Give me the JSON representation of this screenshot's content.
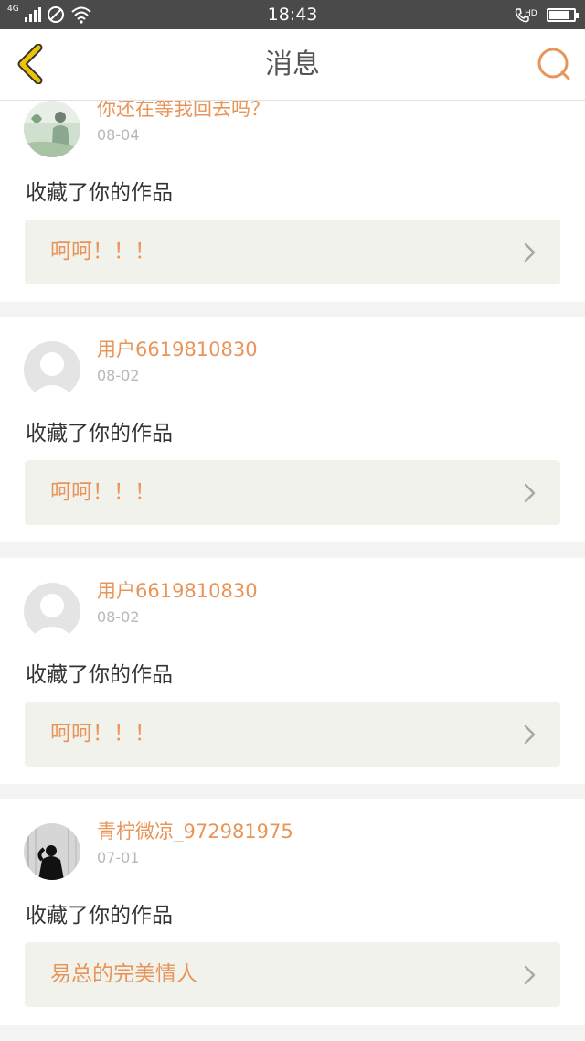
{
  "status_bar": {
    "network": "4G",
    "time": "18:43",
    "call_tag": "HD",
    "battery_level": 0.85
  },
  "header": {
    "title": "消息",
    "back_icon": "chevron-left-icon",
    "search_icon": "search-icon"
  },
  "colors": {
    "accent": "#e8955a",
    "back_arrow": "#f2c200",
    "card_inner": "#f2f2ed"
  },
  "messages": [
    {
      "username": "你还在等我回去吗？",
      "date": "08-04",
      "action": "收藏了你的作品",
      "work_title": "呵呵！！！",
      "avatar_type": "photo-green"
    },
    {
      "username": "用户6619810830",
      "date": "08-02",
      "action": "收藏了你的作品",
      "work_title": "呵呵！！！",
      "avatar_type": "default"
    },
    {
      "username": "用户6619810830",
      "date": "08-02",
      "action": "收藏了你的作品",
      "work_title": "呵呵！！！",
      "avatar_type": "default"
    },
    {
      "username": "青柠微凉_972981975",
      "date": "07-01",
      "action": "收藏了你的作品",
      "work_title": "易总的完美情人",
      "avatar_type": "photo-dark"
    }
  ]
}
